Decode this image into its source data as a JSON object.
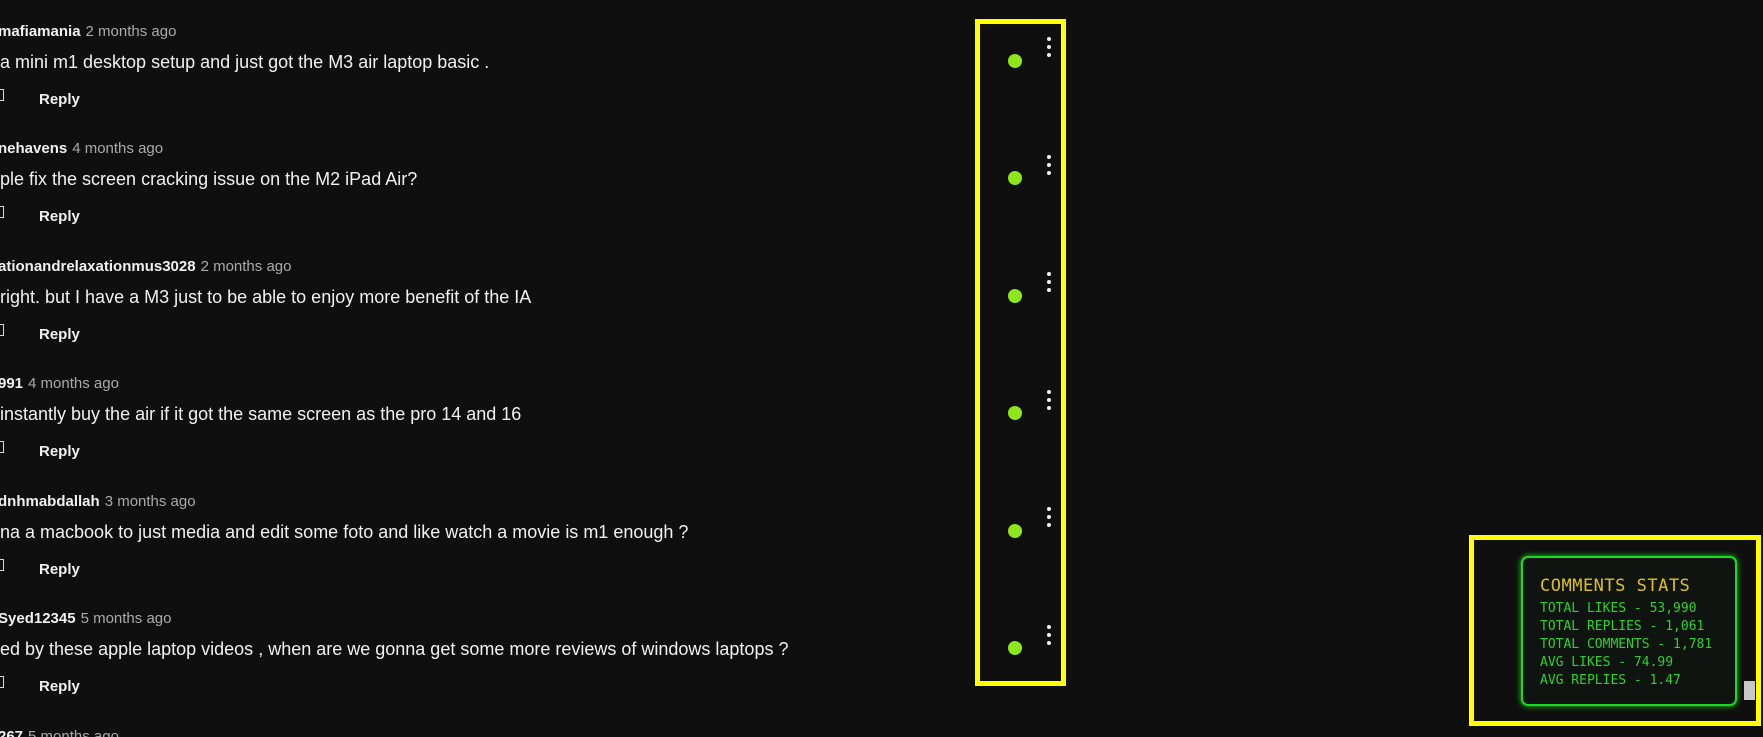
{
  "comments": [
    {
      "author": "mafiamania",
      "time": "2 months ago",
      "text": "a mini m1 desktop setup and just got the M3 air  laptop basic .",
      "reply_label": "Reply"
    },
    {
      "author": "nehavens",
      "time": "4 months ago",
      "text": "ple fix the screen cracking issue on the M2 iPad Air?",
      "reply_label": "Reply"
    },
    {
      "author": "ationandrelaxationmus3028",
      "time": "2 months ago",
      "text": "right. but I have a M3 just to be able to enjoy more benefit of the IA",
      "reply_label": "Reply"
    },
    {
      "author": "991",
      "time": "4 months ago",
      "text": " instantly buy the air if it got the same screen as the pro 14 and 16",
      "reply_label": "Reply"
    },
    {
      "author": "dnhmabdallah",
      "time": "3 months ago",
      "text": "na a macbook to just media and edit some foto and like watch a movie is m1 enough ?",
      "reply_label": "Reply"
    },
    {
      "author": "Syed12345",
      "time": "5 months ago",
      "text": "ed by these apple laptop videos , when are we gonna get some more reviews of windows laptops ?",
      "reply_label": "Reply"
    }
  ],
  "partial_comment": {
    "author": "267",
    "time": "5 months ago"
  },
  "stats": {
    "title": "COMMENTS STATS",
    "total_likes": "TOTAL LIKES - 53,990",
    "total_replies": "TOTAL REPLIES - 1,061",
    "total_comments": "TOTAL COMMENTS - 1,781",
    "avg_likes": "AVG LIKES - 74.99",
    "avg_replies": "AVG REPLIES - 1.47"
  },
  "colors": {
    "background": "#0f0f0f",
    "highlight": "#ffff00",
    "status_dot": "#8ee51a",
    "stats_border": "#1fd81f",
    "stats_title": "#e0c020",
    "stats_text": "#2ed12e"
  }
}
